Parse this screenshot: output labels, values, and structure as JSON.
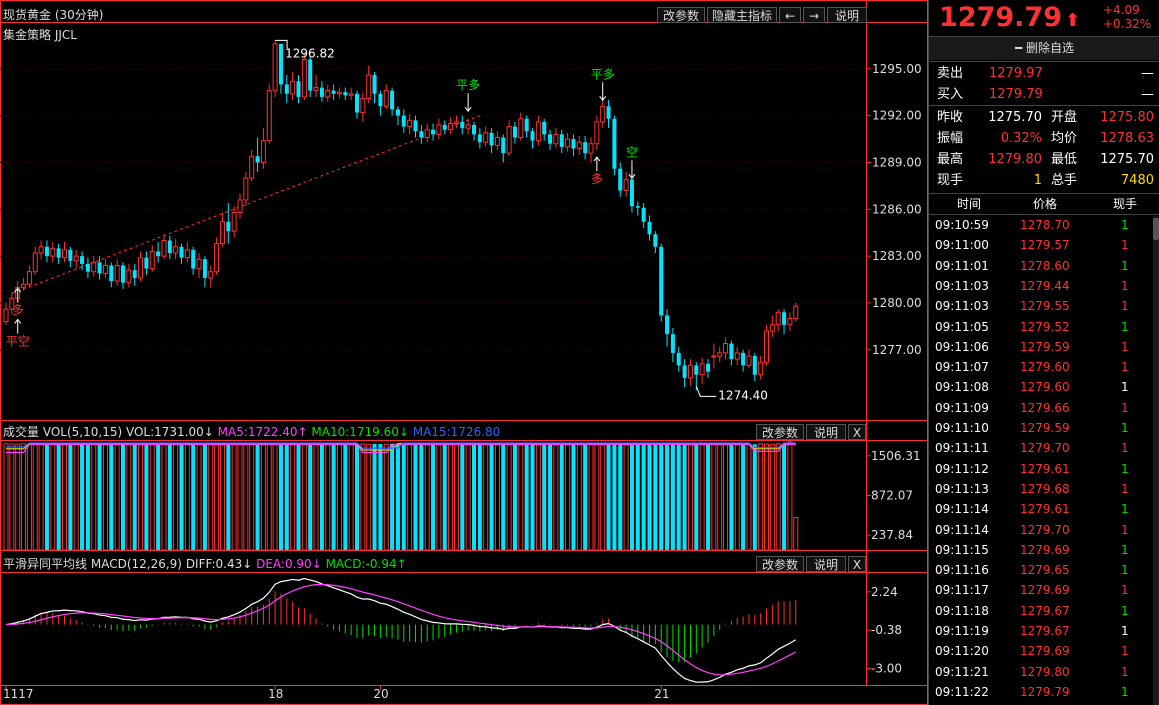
{
  "chart_header": {
    "title": "现货黄金 (30分钟)",
    "strategy": "集金策略 JJCL",
    "buttons": [
      "改参数",
      "隐藏主指标",
      "←",
      "→",
      "说明"
    ]
  },
  "chart_data": [
    {
      "type": "candlestick",
      "ylim": [
        1272.5,
        1298
      ],
      "yticks": [
        "1295.00",
        "1292.00",
        "1289.00",
        "1286.00",
        "1283.00",
        "1280.00",
        "1277.00"
      ],
      "xticks": [
        {
          "label": "1117",
          "index": 0
        },
        {
          "label": "18",
          "index": 46
        },
        {
          "label": "20",
          "index": 64
        },
        {
          "label": "21",
          "index": 112
        }
      ],
      "high_label": "1296.82",
      "low_label": "1274.40",
      "signals": [
        {
          "text": "多",
          "index": 2,
          "price": 1281.2,
          "color": "#ff3030",
          "side": "below"
        },
        {
          "text": "平空",
          "index": 2,
          "price": 1279.2,
          "color": "#ff3030",
          "side": "below"
        },
        {
          "text": "平多",
          "index": 79,
          "price": 1291.9,
          "color": "#00e000",
          "side": "above"
        },
        {
          "text": "平多",
          "index": 102,
          "price": 1292.6,
          "color": "#00e000",
          "side": "above"
        },
        {
          "text": "多",
          "index": 101,
          "price": 1289.6,
          "color": "#ff3030",
          "side": "below"
        },
        {
          "text": "空",
          "index": 107,
          "price": 1287.6,
          "color": "#00e000",
          "side": "above"
        }
      ],
      "candles": [
        [
          1278.8,
          1279.6,
          1278.6,
          1280.0
        ],
        [
          1279.6,
          1280.3,
          1279.3,
          1280.7
        ],
        [
          1280.3,
          1281.0,
          1280.0,
          1281.4
        ],
        [
          1281.0,
          1281.2,
          1280.8,
          1281.6
        ],
        [
          1281.2,
          1282.0,
          1281.0,
          1282.4
        ],
        [
          1282.0,
          1283.2,
          1281.8,
          1283.6
        ],
        [
          1283.2,
          1283.6,
          1282.8,
          1284.0
        ],
        [
          1283.6,
          1283.0,
          1282.6,
          1284.0
        ],
        [
          1283.0,
          1283.5,
          1282.6,
          1283.9
        ],
        [
          1283.5,
          1282.9,
          1282.5,
          1283.8
        ],
        [
          1282.9,
          1283.4,
          1282.6,
          1283.9
        ],
        [
          1283.4,
          1282.7,
          1282.3,
          1283.6
        ],
        [
          1282.7,
          1283.0,
          1282.2,
          1283.4
        ],
        [
          1283.0,
          1282.5,
          1282.1,
          1283.3
        ],
        [
          1282.5,
          1282.0,
          1281.6,
          1282.9
        ],
        [
          1282.0,
          1282.6,
          1281.7,
          1283.0
        ],
        [
          1282.6,
          1281.9,
          1281.5,
          1283.0
        ],
        [
          1281.9,
          1282.4,
          1281.6,
          1282.8
        ],
        [
          1282.4,
          1281.4,
          1281.0,
          1282.6
        ],
        [
          1281.4,
          1282.4,
          1281.1,
          1282.8
        ],
        [
          1282.4,
          1281.3,
          1280.9,
          1282.6
        ],
        [
          1281.3,
          1282.1,
          1281.0,
          1282.5
        ],
        [
          1282.1,
          1281.6,
          1281.1,
          1282.5
        ],
        [
          1281.6,
          1282.9,
          1281.4,
          1283.3
        ],
        [
          1282.9,
          1282.2,
          1281.8,
          1283.3
        ],
        [
          1282.2,
          1283.3,
          1282.0,
          1283.7
        ],
        [
          1283.3,
          1283.0,
          1282.6,
          1283.9
        ],
        [
          1283.0,
          1284.0,
          1282.8,
          1284.4
        ],
        [
          1284.0,
          1283.2,
          1282.8,
          1284.3
        ],
        [
          1283.2,
          1283.6,
          1282.8,
          1284.1
        ],
        [
          1283.6,
          1282.9,
          1282.5,
          1283.8
        ],
        [
          1282.9,
          1283.4,
          1282.6,
          1283.9
        ],
        [
          1283.4,
          1282.2,
          1281.8,
          1283.6
        ],
        [
          1282.2,
          1282.8,
          1281.6,
          1283.2
        ],
        [
          1282.8,
          1281.6,
          1281.0,
          1283.0
        ],
        [
          1281.6,
          1282.0,
          1281.0,
          1282.4
        ],
        [
          1282.0,
          1283.8,
          1281.8,
          1284.2
        ],
        [
          1283.8,
          1285.2,
          1283.6,
          1285.8
        ],
        [
          1285.2,
          1284.6,
          1283.8,
          1286.4
        ],
        [
          1284.6,
          1285.8,
          1284.2,
          1286.2
        ],
        [
          1285.8,
          1286.6,
          1285.4,
          1287.0
        ],
        [
          1286.6,
          1288.0,
          1286.2,
          1288.4
        ],
        [
          1288.0,
          1289.4,
          1287.8,
          1289.8
        ],
        [
          1289.4,
          1289.0,
          1288.4,
          1290.6
        ],
        [
          1289.0,
          1290.4,
          1288.6,
          1291.2
        ],
        [
          1290.4,
          1293.6,
          1290.2,
          1294.0
        ],
        [
          1293.6,
          1296.6,
          1293.2,
          1296.82
        ],
        [
          1296.6,
          1294.0,
          1293.4,
          1296.6
        ],
        [
          1294.0,
          1293.4,
          1292.8,
          1294.6
        ],
        [
          1293.4,
          1294.2,
          1293.0,
          1294.8
        ],
        [
          1294.2,
          1293.2,
          1292.8,
          1294.6
        ],
        [
          1293.2,
          1295.6,
          1293.0,
          1296.0
        ],
        [
          1295.6,
          1293.6,
          1293.2,
          1295.8
        ],
        [
          1293.6,
          1293.8,
          1293.2,
          1294.6
        ],
        [
          1293.8,
          1293.2,
          1292.9,
          1294.2
        ],
        [
          1293.2,
          1293.6,
          1292.9,
          1294.0
        ],
        [
          1293.6,
          1293.4,
          1293.0,
          1294.0
        ],
        [
          1293.4,
          1293.5,
          1293.1,
          1293.8
        ],
        [
          1293.5,
          1293.3,
          1293.0,
          1293.8
        ],
        [
          1293.3,
          1293.4,
          1293.0,
          1293.8
        ],
        [
          1293.4,
          1292.2,
          1291.8,
          1293.6
        ],
        [
          1292.2,
          1293.1,
          1291.6,
          1293.5
        ],
        [
          1293.1,
          1294.6,
          1292.8,
          1295.2
        ],
        [
          1294.6,
          1293.4,
          1292.8,
          1294.8
        ],
        [
          1293.4,
          1292.6,
          1292.0,
          1293.6
        ],
        [
          1292.6,
          1293.6,
          1292.4,
          1294.0
        ],
        [
          1293.6,
          1292.4,
          1292.0,
          1293.8
        ],
        [
          1292.4,
          1292.0,
          1291.4,
          1292.6
        ],
        [
          1292.0,
          1291.3,
          1290.9,
          1292.4
        ],
        [
          1291.3,
          1291.7,
          1290.8,
          1292.1
        ],
        [
          1291.7,
          1291.0,
          1290.6,
          1292.0
        ],
        [
          1291.0,
          1290.6,
          1290.2,
          1291.4
        ],
        [
          1290.6,
          1291.1,
          1290.3,
          1291.5
        ],
        [
          1291.1,
          1290.8,
          1290.4,
          1291.5
        ],
        [
          1290.8,
          1291.4,
          1290.5,
          1291.8
        ],
        [
          1291.4,
          1291.1,
          1290.8,
          1291.7
        ],
        [
          1291.1,
          1291.5,
          1290.8,
          1291.9
        ],
        [
          1291.5,
          1291.6,
          1291.2,
          1292.0
        ],
        [
          1291.6,
          1291.2,
          1290.8,
          1292.0
        ],
        [
          1291.2,
          1291.4,
          1290.8,
          1291.8
        ],
        [
          1291.4,
          1290.8,
          1290.4,
          1291.6
        ],
        [
          1290.8,
          1290.3,
          1289.9,
          1291.2
        ],
        [
          1290.3,
          1290.9,
          1290.0,
          1291.3
        ],
        [
          1290.9,
          1290.1,
          1289.6,
          1291.2
        ],
        [
          1290.1,
          1290.6,
          1289.8,
          1291.0
        ],
        [
          1290.6,
          1289.6,
          1289.0,
          1290.8
        ],
        [
          1289.6,
          1291.3,
          1289.4,
          1291.7
        ],
        [
          1291.3,
          1290.6,
          1290.2,
          1291.6
        ],
        [
          1290.6,
          1291.8,
          1290.4,
          1292.2
        ],
        [
          1291.8,
          1291.0,
          1290.6,
          1292.0
        ],
        [
          1291.0,
          1290.4,
          1289.9,
          1291.2
        ],
        [
          1290.4,
          1291.6,
          1290.1,
          1292.0
        ],
        [
          1291.6,
          1290.8,
          1290.4,
          1291.8
        ],
        [
          1290.8,
          1290.2,
          1289.8,
          1291.1
        ],
        [
          1290.2,
          1290.8,
          1289.9,
          1291.2
        ],
        [
          1290.8,
          1290.0,
          1289.6,
          1291.1
        ],
        [
          1290.0,
          1290.5,
          1289.7,
          1290.9
        ],
        [
          1290.5,
          1289.9,
          1289.4,
          1290.8
        ],
        [
          1289.9,
          1290.3,
          1289.5,
          1290.7
        ],
        [
          1290.3,
          1289.6,
          1289.2,
          1290.7
        ],
        [
          1289.6,
          1290.2,
          1289.0,
          1290.6
        ],
        [
          1290.2,
          1291.6,
          1289.8,
          1292.0
        ],
        [
          1291.6,
          1292.6,
          1291.2,
          1293.2
        ],
        [
          1292.6,
          1291.8,
          1291.2,
          1293.0
        ],
        [
          1291.8,
          1288.6,
          1288.2,
          1292.0
        ],
        [
          1288.6,
          1287.2,
          1286.8,
          1289.0
        ],
        [
          1287.2,
          1287.9,
          1286.8,
          1288.4
        ],
        [
          1287.9,
          1286.2,
          1285.8,
          1288.2
        ],
        [
          1286.2,
          1286.1,
          1285.6,
          1286.5
        ],
        [
          1286.1,
          1285.2,
          1284.8,
          1286.4
        ],
        [
          1285.2,
          1284.4,
          1284.0,
          1285.6
        ],
        [
          1284.4,
          1283.6,
          1283.2,
          1284.6
        ],
        [
          1283.6,
          1279.2,
          1278.8,
          1283.8
        ],
        [
          1279.2,
          1278.0,
          1277.2,
          1279.6
        ],
        [
          1278.0,
          1276.8,
          1276.2,
          1278.4
        ],
        [
          1276.8,
          1276.0,
          1275.6,
          1277.2
        ],
        [
          1276.0,
          1275.2,
          1274.6,
          1276.4
        ],
        [
          1275.2,
          1276.0,
          1274.7,
          1276.4
        ],
        [
          1276.0,
          1275.4,
          1274.4,
          1276.2
        ],
        [
          1275.4,
          1276.1,
          1274.8,
          1276.5
        ],
        [
          1276.1,
          1275.6,
          1275.2,
          1276.4
        ],
        [
          1276.6,
          1276.6,
          1275.8,
          1277.4
        ],
        [
          1276.6,
          1276.8,
          1276.2,
          1277.2
        ],
        [
          1276.8,
          1277.4,
          1276.4,
          1277.8
        ],
        [
          1277.4,
          1276.4,
          1276.0,
          1277.6
        ],
        [
          1276.4,
          1276.8,
          1276.0,
          1277.2
        ],
        [
          1276.8,
          1276.0,
          1275.6,
          1277.0
        ],
        [
          1276.0,
          1276.6,
          1275.8,
          1277.0
        ],
        [
          1276.6,
          1275.4,
          1275.0,
          1276.8
        ],
        [
          1275.4,
          1276.2,
          1275.1,
          1276.6
        ],
        [
          1276.2,
          1278.2,
          1276.0,
          1278.6
        ],
        [
          1278.2,
          1278.6,
          1277.8,
          1279.2
        ],
        [
          1278.6,
          1279.4,
          1278.2,
          1279.6
        ],
        [
          1279.4,
          1278.6,
          1278.0,
          1279.6
        ],
        [
          1278.6,
          1279.0,
          1278.2,
          1279.4
        ],
        [
          1279.0,
          1279.79,
          1278.8,
          1280.0
        ]
      ]
    },
    {
      "type": "bar",
      "title": "成交量",
      "legend": [
        {
          "text": "VOL(5,10,15)",
          "color": "#dddddd"
        },
        {
          "text": "VOL:1731.00↓",
          "color": "#dddddd"
        },
        {
          "text": "MA5:1722.40↑",
          "color": "#ff40ff"
        },
        {
          "text": "MA10:1719.60↓",
          "color": "#00e000"
        },
        {
          "text": "MA15:1726.80",
          "color": "#3060ff"
        }
      ],
      "yticks": [
        "1506.31",
        "872.07",
        "237.84"
      ],
      "ylim": [
        0,
        1760
      ],
      "last_bar_values": [
        1731.0,
        980.0,
        520.0
      ],
      "buttons": [
        "改参数",
        "说明",
        "X"
      ]
    },
    {
      "type": "line",
      "title": "平滑异同平均线",
      "legend": [
        {
          "text": "MACD(12,26,9)",
          "color": "#dddddd"
        },
        {
          "text": "DIFF:0.43↓",
          "color": "#dddddd"
        },
        {
          "text": "DEA:0.90↓",
          "color": "#ff40ff"
        },
        {
          "text": "MACD:-0.94↑",
          "color": "#00e000"
        }
      ],
      "yticks": [
        "2.24",
        "-0.38",
        "-3.00"
      ],
      "buttons": [
        "改参数",
        "说明",
        "X"
      ]
    }
  ],
  "quote": {
    "price": "1279.79",
    "arrow": "⬆",
    "change": "+4.09",
    "change_pct": "+0.32%",
    "watch_button": "━ 删除自选",
    "sell_label": "卖出",
    "sell_price": "1279.97",
    "sell_vol": "—",
    "buy_label": "买入",
    "buy_price": "1279.79",
    "buy_vol": "—",
    "stats": [
      {
        "l1": "昨收",
        "v1": "1275.70",
        "c1": "white",
        "l2": "开盘",
        "v2": "1275.80",
        "c2": "red"
      },
      {
        "l1": "振幅",
        "v1": "0.32%",
        "c1": "red",
        "l2": "均价",
        "v2": "1278.63",
        "c2": "red"
      },
      {
        "l1": "最高",
        "v1": "1279.80",
        "c1": "red",
        "l2": "最低",
        "v2": "1275.70",
        "c2": "white"
      },
      {
        "l1": "现手",
        "v1": "1",
        "c1": "yellow",
        "l2": "总手",
        "v2": "7480",
        "c2": "yellow"
      }
    ],
    "tick_headers": [
      "时间",
      "价格",
      "现手"
    ],
    "ticks": [
      {
        "time": "09:10:59",
        "price": "1278.70",
        "vol": "1",
        "vc": "green"
      },
      {
        "time": "09:11:00",
        "price": "1279.57",
        "vol": "1",
        "vc": "red"
      },
      {
        "time": "09:11:01",
        "price": "1278.60",
        "vol": "1",
        "vc": "green"
      },
      {
        "time": "09:11:03",
        "price": "1279.44",
        "vol": "1",
        "vc": "red"
      },
      {
        "time": "09:11:03",
        "price": "1279.55",
        "vol": "1",
        "vc": "red"
      },
      {
        "time": "09:11:05",
        "price": "1279.52",
        "vol": "1",
        "vc": "green"
      },
      {
        "time": "09:11:06",
        "price": "1279.59",
        "vol": "1",
        "vc": "red"
      },
      {
        "time": "09:11:07",
        "price": "1279.60",
        "vol": "1",
        "vc": "red"
      },
      {
        "time": "09:11:08",
        "price": "1279.60",
        "vol": "1",
        "vc": "white"
      },
      {
        "time": "09:11:09",
        "price": "1279.66",
        "vol": "1",
        "vc": "red"
      },
      {
        "time": "09:11:10",
        "price": "1279.59",
        "vol": "1",
        "vc": "green"
      },
      {
        "time": "09:11:11",
        "price": "1279.70",
        "vol": "1",
        "vc": "red"
      },
      {
        "time": "09:11:12",
        "price": "1279.61",
        "vol": "1",
        "vc": "green"
      },
      {
        "time": "09:11:13",
        "price": "1279.68",
        "vol": "1",
        "vc": "red"
      },
      {
        "time": "09:11:14",
        "price": "1279.61",
        "vol": "1",
        "vc": "green"
      },
      {
        "time": "09:11:14",
        "price": "1279.70",
        "vol": "1",
        "vc": "red"
      },
      {
        "time": "09:11:15",
        "price": "1279.69",
        "vol": "1",
        "vc": "green"
      },
      {
        "time": "09:11:16",
        "price": "1279.65",
        "vol": "1",
        "vc": "green"
      },
      {
        "time": "09:11:17",
        "price": "1279.69",
        "vol": "1",
        "vc": "red"
      },
      {
        "time": "09:11:18",
        "price": "1279.67",
        "vol": "1",
        "vc": "green"
      },
      {
        "time": "09:11:19",
        "price": "1279.67",
        "vol": "1",
        "vc": "white"
      },
      {
        "time": "09:11:20",
        "price": "1279.69",
        "vol": "1",
        "vc": "red"
      },
      {
        "time": "09:11:21",
        "price": "1279.80",
        "vol": "1",
        "vc": "red"
      },
      {
        "time": "09:11:22",
        "price": "1279.79",
        "vol": "1",
        "vc": "green"
      }
    ]
  },
  "colors": {
    "up": "#ff3030",
    "down": "#00e5ff",
    "grid": "#3a0000",
    "axis": "#ff3030"
  }
}
